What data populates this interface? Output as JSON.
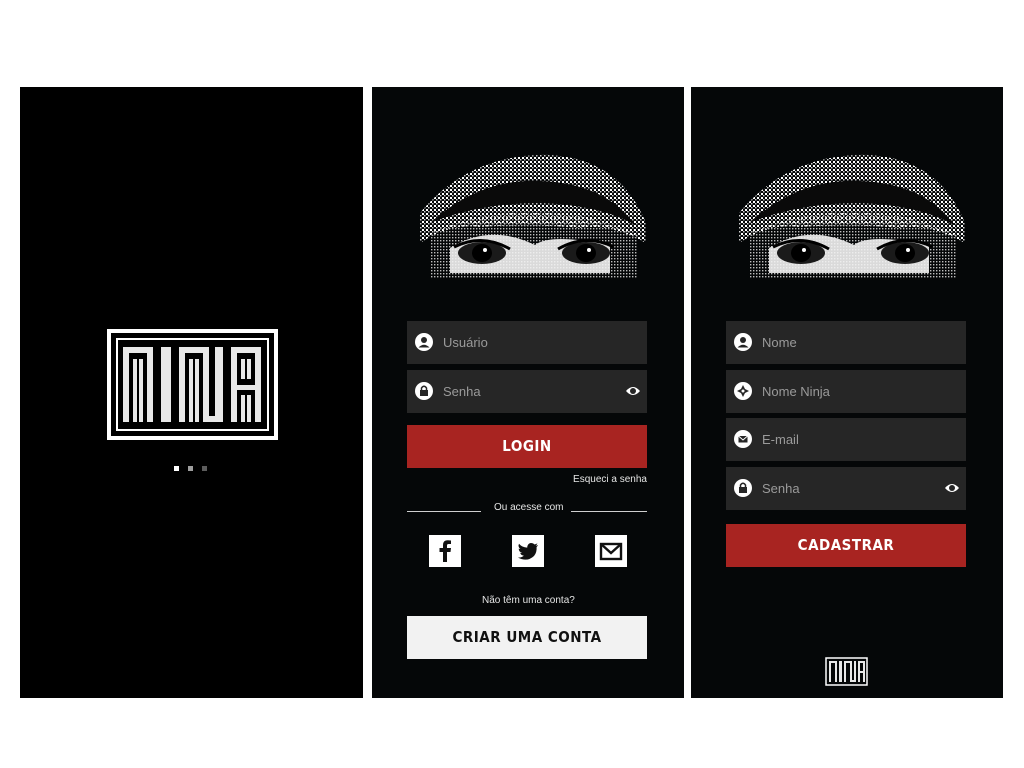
{
  "splash": {
    "logo_text": "NINJA",
    "loading_dots": 3
  },
  "login": {
    "username_placeholder": "Usuário",
    "password_placeholder": "Senha",
    "login_button": "LOGIN",
    "forgot_password": "Esqueci a senha",
    "divider_text": "Ou acesse com",
    "social": [
      {
        "name": "facebook-icon"
      },
      {
        "name": "twitter-icon"
      },
      {
        "name": "gmail-icon"
      }
    ],
    "no_account": "Não têm uma conta?",
    "create_account_button": "CRIAR UMA CONTA"
  },
  "register": {
    "name_placeholder": "Nome",
    "ninja_name_placeholder": "Nome Ninja",
    "email_placeholder": "E-mail",
    "password_placeholder": "Senha",
    "register_button": "CADASTRAR",
    "footer_logo_text": "NINJA"
  },
  "colors": {
    "background": "#050708",
    "field": "#262626",
    "accent_red": "#a82421",
    "button_light": "#f2f2f2",
    "placeholder": "#9a9a9a"
  }
}
